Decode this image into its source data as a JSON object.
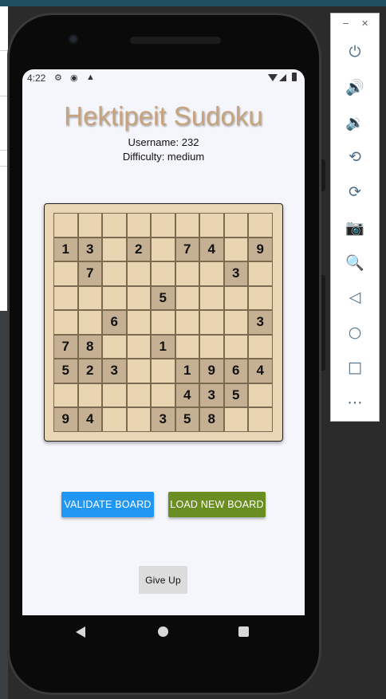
{
  "status_bar": {
    "time": "4:22"
  },
  "app": {
    "title": "Hektipeit Sudoku",
    "username": "Username: 232",
    "difficulty": "Difficulty: medium"
  },
  "board": {
    "rows": [
      [
        "",
        "",
        "",
        "",
        "",
        "",
        "",
        "",
        ""
      ],
      [
        "1",
        "3",
        "",
        "2",
        "",
        "7",
        "4",
        "",
        "9"
      ],
      [
        "",
        "7",
        "",
        "",
        "",
        "",
        "",
        "3",
        ""
      ],
      [
        "",
        "",
        "",
        "",
        "5",
        "",
        "",
        "",
        ""
      ],
      [
        "",
        "",
        "6",
        "",
        "",
        "",
        "",
        "",
        "3"
      ],
      [
        "7",
        "8",
        "",
        "",
        "1",
        "",
        "",
        "",
        ""
      ],
      [
        "5",
        "2",
        "3",
        "",
        "",
        "1",
        "9",
        "6",
        "4"
      ],
      [
        "",
        "",
        "",
        "",
        "",
        "4",
        "3",
        "5",
        ""
      ],
      [
        "9",
        "4",
        "",
        "",
        "3",
        "5",
        "8",
        "",
        ""
      ]
    ],
    "cell_color": "#e9d5b1",
    "given_cell_color": "#c6b093"
  },
  "buttons": {
    "validate": "VALIDATE BOARD",
    "load_new": "LOAD NEW BOARD",
    "give_up": "Give Up"
  },
  "colors": {
    "title": "#c8a47e",
    "validate_button": "#2196f3",
    "load_button": "#6b8e23",
    "give_up_button": "#dcdcdc",
    "screen_background": "#f5f6fc"
  },
  "emulator_panel": {
    "icons": [
      "power-icon",
      "volume-up-icon",
      "volume-down-icon",
      "rotate-left-icon",
      "rotate-right-icon",
      "camera-icon",
      "zoom-icon",
      "back-icon",
      "home-icon",
      "overview-icon",
      "more-icon"
    ]
  }
}
